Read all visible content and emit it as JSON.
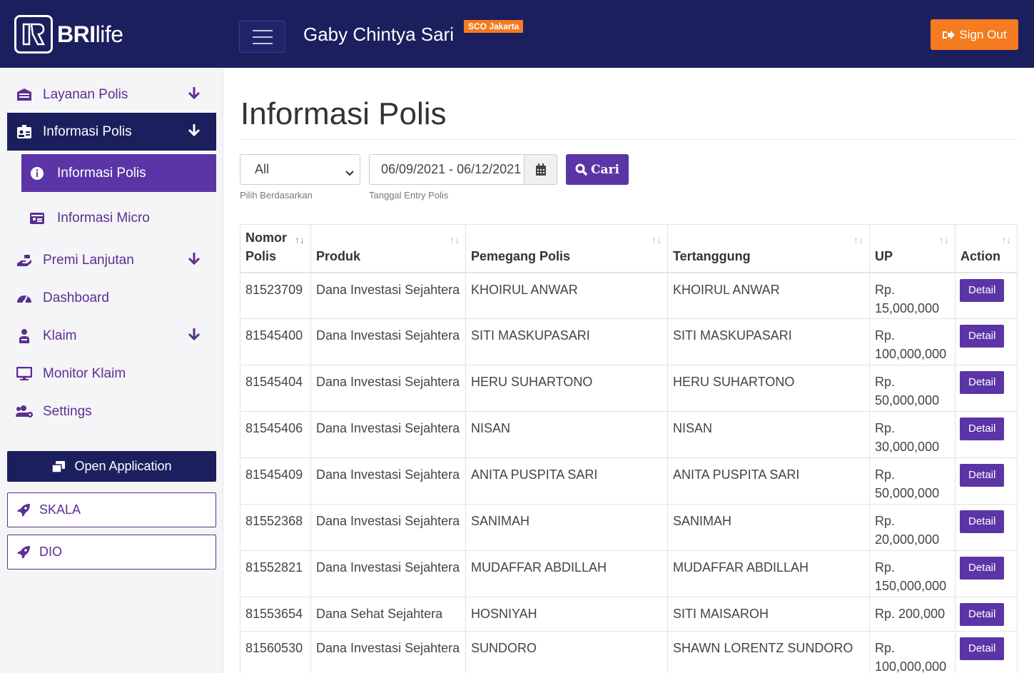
{
  "header": {
    "brand_bold": "BRI",
    "brand_light": "life",
    "user_name": "Gaby Chintya Sari",
    "branch": "SCO Jakarta",
    "signout_label": "Sign Out"
  },
  "sidebar": {
    "items": [
      {
        "label": "Layanan Polis"
      },
      {
        "label": "Informasi Polis"
      },
      {
        "label": "Informasi Polis"
      },
      {
        "label": "Informasi Micro"
      },
      {
        "label": "Premi Lanjutan"
      },
      {
        "label": "Dashboard"
      },
      {
        "label": "Klaim"
      },
      {
        "label": "Monitor Klaim"
      },
      {
        "label": "Settings"
      }
    ],
    "open_app_label": "Open Application",
    "skala_label": "SKALA",
    "dio_label": "DIO"
  },
  "main": {
    "title": "Informasi Polis",
    "filter": {
      "select_value": "All",
      "select_help": "Pilih Berdasarkan",
      "date_value": "06/09/2021 - 06/12/2021",
      "date_help": "Tanggal Entry Polis",
      "search_label": "Cari"
    },
    "table": {
      "headers": [
        "Nomor Polis",
        "Produk",
        "Pemegang Polis",
        "Tertanggung",
        "UP",
        "Action"
      ],
      "action_label": "Detail",
      "rows": [
        {
          "nomor": "81523709",
          "produk": "Dana Investasi Sejahtera",
          "pemegang": "KHOIRUL ANWAR",
          "tertanggung": "KHOIRUL ANWAR",
          "up_prefix": "Rp.",
          "up": "15,000,000"
        },
        {
          "nomor": "81545400",
          "produk": "Dana Investasi Sejahtera",
          "pemegang": "SITI MASKUPASARI",
          "tertanggung": "SITI MASKUPASARI",
          "up_prefix": "Rp.",
          "up": "100,000,000"
        },
        {
          "nomor": "81545404",
          "produk": "Dana Investasi Sejahtera",
          "pemegang": "HERU SUHARTONO",
          "tertanggung": "HERU SUHARTONO",
          "up_prefix": "Rp.",
          "up": "50,000,000"
        },
        {
          "nomor": "81545406",
          "produk": "Dana Investasi Sejahtera",
          "pemegang": "NISAN",
          "tertanggung": "NISAN",
          "up_prefix": "Rp.",
          "up": "30,000,000"
        },
        {
          "nomor": "81545409",
          "produk": "Dana Investasi Sejahtera",
          "pemegang": "ANITA PUSPITA SARI",
          "tertanggung": "ANITA PUSPITA SARI",
          "up_prefix": "Rp.",
          "up": "50,000,000"
        },
        {
          "nomor": "81552368",
          "produk": "Dana Investasi Sejahtera",
          "pemegang": "SANIMAH",
          "tertanggung": "SANIMAH",
          "up_prefix": "Rp.",
          "up": "20,000,000"
        },
        {
          "nomor": "81552821",
          "produk": "Dana Investasi Sejahtera",
          "pemegang": "MUDAFFAR ABDILLAH",
          "tertanggung": "MUDAFFAR ABDILLAH",
          "up_prefix": "Rp.",
          "up": "150,000,000"
        },
        {
          "nomor": "81553654",
          "produk": "Dana Sehat Sejahtera",
          "pemegang": "HOSNIYAH",
          "tertanggung": "SITI MAISAROH",
          "up_prefix": "Rp.",
          "up": "200,000"
        },
        {
          "nomor": "81560530",
          "produk": "Dana Investasi Sejahtera",
          "pemegang": "SUNDORO",
          "tertanggung": "SHAWN LORENTZ SUNDORO",
          "up_prefix": "Rp.",
          "up": "100,000,000"
        }
      ]
    }
  },
  "colors": {
    "navy": "#1b1f5e",
    "purple": "#5b35a6",
    "orange": "#f47b20"
  }
}
